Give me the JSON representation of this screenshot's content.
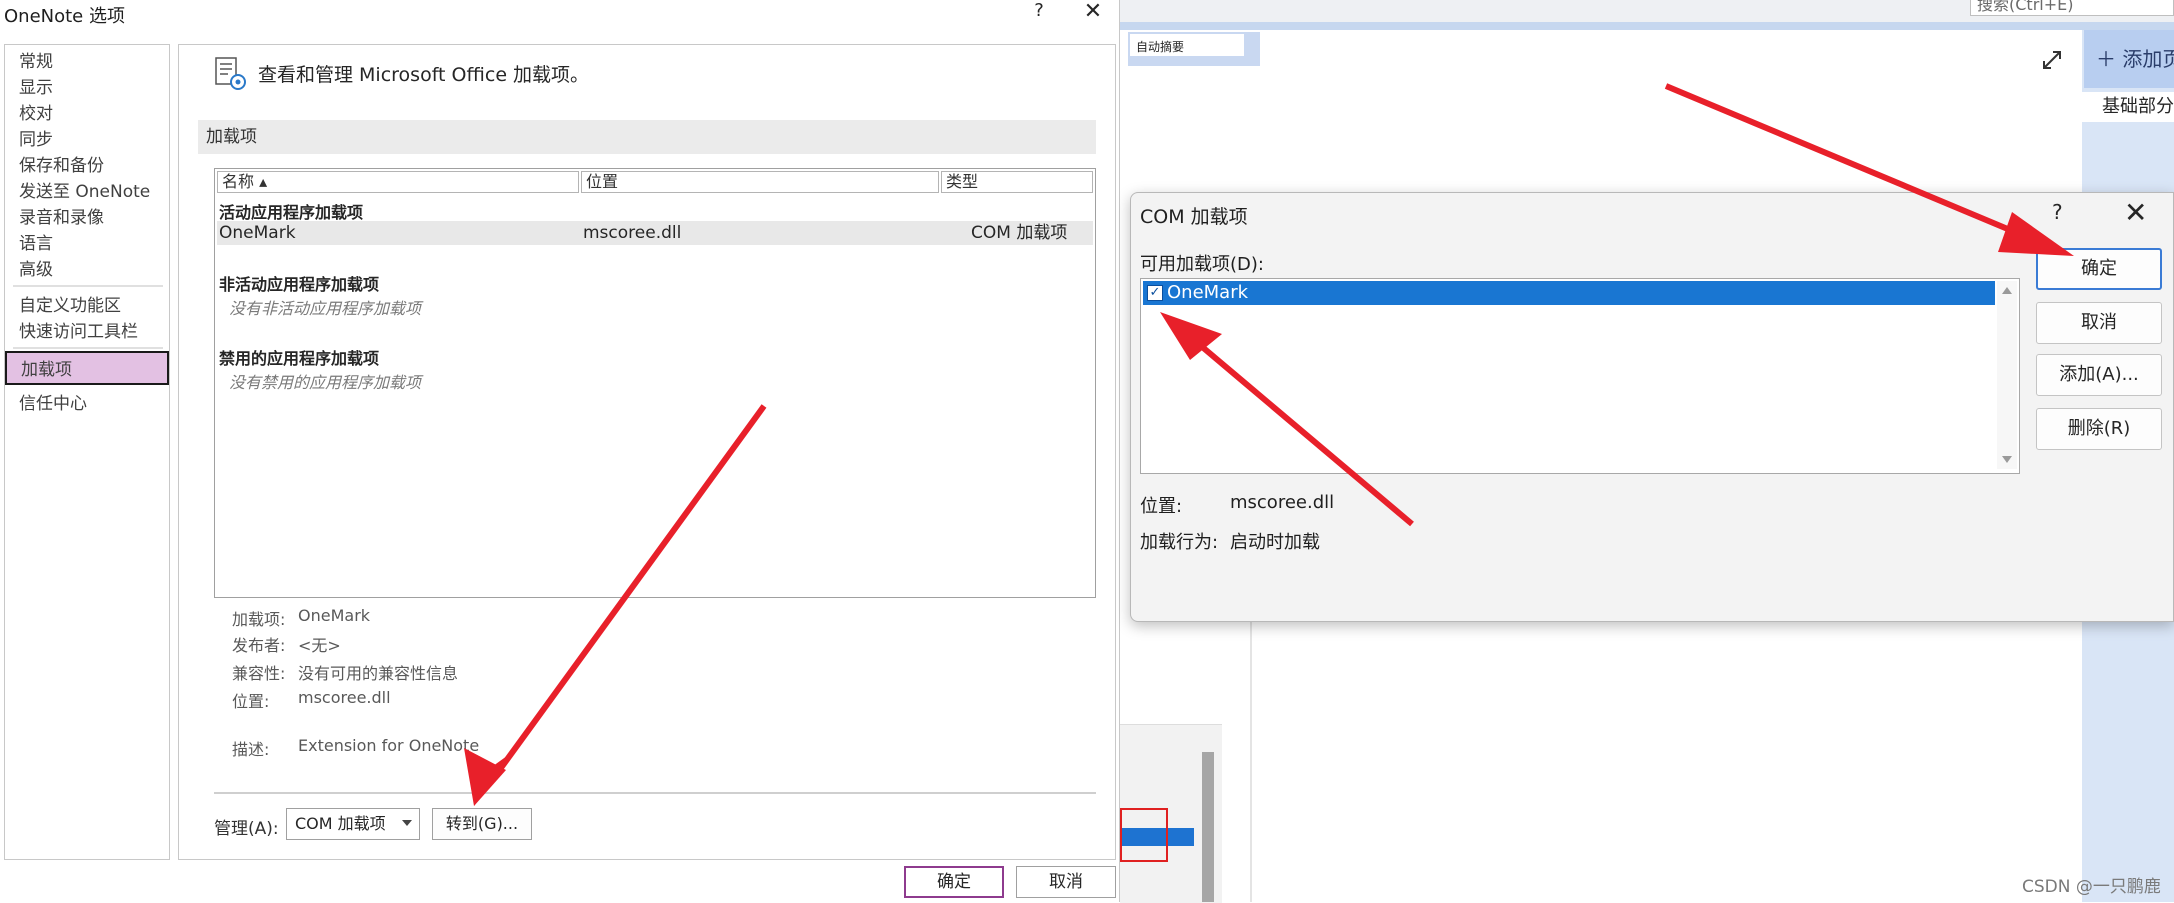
{
  "options_dialog": {
    "title": "OneNote 选项",
    "help": "?",
    "close": "✕",
    "nav": [
      "常规",
      "显示",
      "校对",
      "同步",
      "保存和备份",
      "发送至 OneNote",
      "录音和录像",
      "语言",
      "高级",
      "自定义功能区",
      "快速访问工具栏",
      "加载项",
      "信任中心"
    ],
    "selected_nav": "加载项",
    "header_text": "查看和管理 Microsoft Office 加载项。",
    "section_title": "加载项",
    "columns": {
      "name": "名称 ▴",
      "location": "位置",
      "type": "类型"
    },
    "active_group": "活动应用程序加载项",
    "addin_row": {
      "name": "OneMark",
      "location": "mscoree.dll",
      "type": "COM 加载项"
    },
    "inactive_group": "非活动应用程序加载项",
    "inactive_empty": "没有非活动应用程序加载项",
    "disabled_group": "禁用的应用程序加载项",
    "disabled_empty": "没有禁用的应用程序加载项",
    "details": {
      "addin_label": "加载项:",
      "addin_value": "OneMark",
      "publisher_label": "发布者:",
      "publisher_value": "<无>",
      "compat_label": "兼容性:",
      "compat_value": "没有可用的兼容性信息",
      "location_label": "位置:",
      "location_value": "mscoree.dll",
      "desc_label": "描述:",
      "desc_value": "Extension for OneNote"
    },
    "manage_label": "管理(A):",
    "manage_value": "COM 加载项",
    "goto_label": "转到(G)...",
    "ok_label": "确定",
    "cancel_label": "取消"
  },
  "com_dialog": {
    "title": "COM 加载项",
    "help": "?",
    "close": "✕",
    "list_label": "可用加载项(D):",
    "item": {
      "label": "OneMark",
      "checked": true
    },
    "location_label": "位置:",
    "location_value": "mscoree.dll",
    "load_label": "加载行为:",
    "load_value": "启动时加载",
    "buttons": {
      "ok": "确定",
      "cancel": "取消",
      "add": "添加(A)...",
      "remove": "删除(R)"
    }
  },
  "background": {
    "search_text": "搜索(Ctrl+E)",
    "autosummary": "自动摘要",
    "add_button": "＋ 添加页",
    "basic_label": "基础部分"
  },
  "watermark": "CSDN @一只鹏鹿",
  "colors": {
    "selection_blue": "#1976d2",
    "nav_selected": "#e3c1e3",
    "arrow_red": "#e8202a"
  }
}
